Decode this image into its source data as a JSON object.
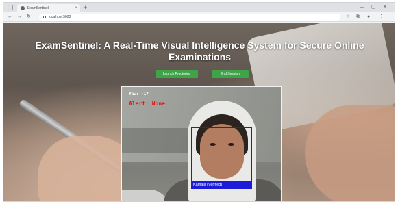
{
  "browser": {
    "tab": {
      "title": "ExamSentinel",
      "close_glyph": "×"
    },
    "new_tab_glyph": "+",
    "window_controls": {
      "minimize": "—",
      "maximize": "▢",
      "close": "✕"
    },
    "toolbar": {
      "back": "←",
      "forward": "→",
      "reload": "↻",
      "url": "localhost:5000",
      "star": "☆",
      "extensions": "⧉",
      "menu": "⋮"
    }
  },
  "page": {
    "title": "ExamSentinel: A Real-Time Visual Intelligence System for Secure Online Examinations",
    "buttons": {
      "launch": "Launch Proctoring",
      "end": "End Session"
    },
    "camera_feed": {
      "yaw_text": "Yaw: -17",
      "alert_text": "Alert: None",
      "face_label": "Kamala (Verified)"
    }
  },
  "colors": {
    "accent_green": "#3fa447",
    "alert_red": "#e21414",
    "face_box_blue": "#1b1bd8"
  },
  "icons": [
    "favicon-icon",
    "close-icon",
    "plus-icon",
    "back-arrow-icon",
    "forward-arrow-icon",
    "reload-icon",
    "lock-icon",
    "star-icon",
    "extensions-icon",
    "menu-icon"
  ]
}
